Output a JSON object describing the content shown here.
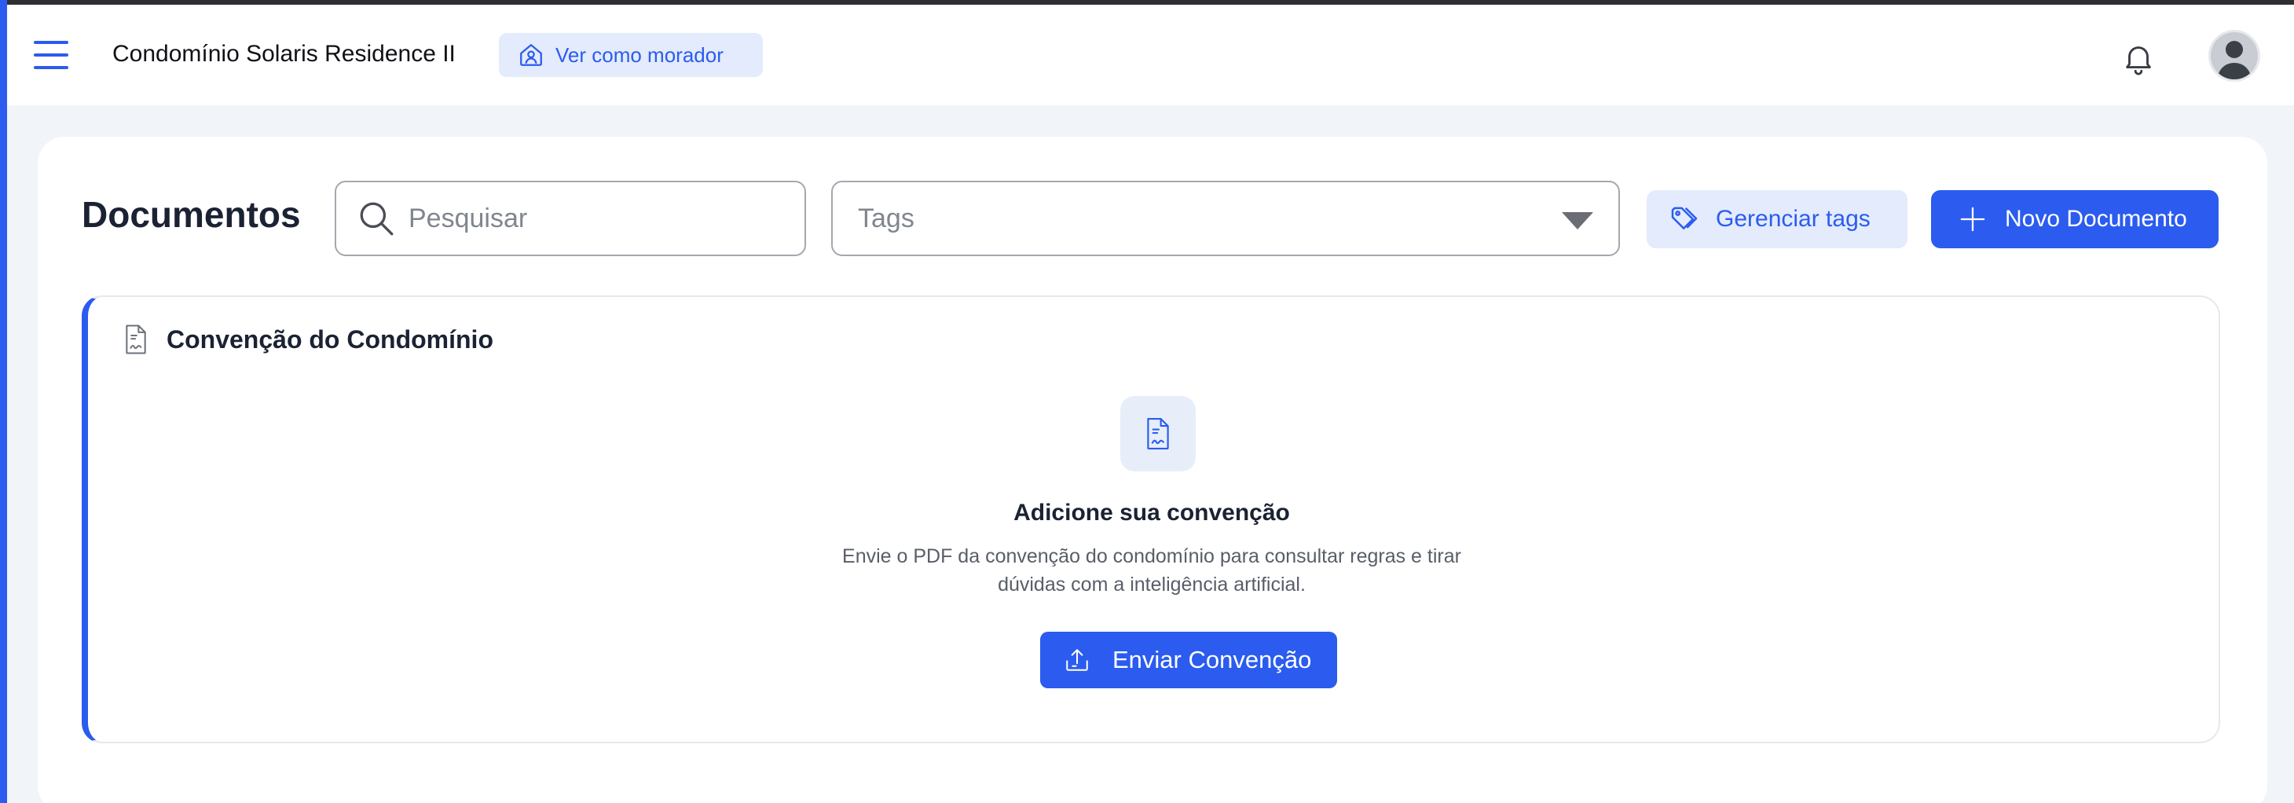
{
  "header": {
    "menu_icon": "hamburger-menu-icon",
    "condo_name": "Condomínio Solaris Residence II",
    "view_as_label": "Ver como morador",
    "view_as_icon": "home-user-icon",
    "notifications_icon": "bell-icon",
    "avatar_icon": "user-avatar"
  },
  "documents": {
    "title": "Documentos",
    "search": {
      "placeholder": "Pesquisar",
      "value": "",
      "icon": "search-icon"
    },
    "tags_select": {
      "placeholder": "Tags",
      "icon": "caret-down-icon"
    },
    "manage_tags_label": "Gerenciar tags",
    "manage_tags_icon": "tags-icon",
    "new_document_label": "Novo Documento",
    "new_document_icon": "plus-icon"
  },
  "convention": {
    "title": "Convenção do Condomínio",
    "title_icon": "document-icon",
    "empty_icon": "document-icon",
    "empty_heading": "Adicione sua convenção",
    "empty_description": "Envie o PDF da convenção do condomínio para consultar regras e tirar dúvidas com a inteligência artificial.",
    "upload_label": "Enviar Convenção",
    "upload_icon": "upload-icon"
  },
  "colors": {
    "accent": "#2b5cef",
    "accent_light": "#e3ebfc",
    "background": "#f1f4f9",
    "text_dark": "#1a2233",
    "text_muted": "#585e68"
  }
}
